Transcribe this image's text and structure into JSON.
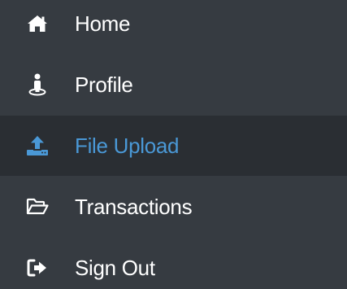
{
  "colors": {
    "background": "#363b41",
    "active_background": "#2a2e33",
    "text": "#ffffff",
    "accent": "#4a98d6"
  },
  "sidebar": {
    "items": [
      {
        "label": "Home",
        "icon": "home-icon",
        "active": false
      },
      {
        "label": "Profile",
        "icon": "user-icon",
        "active": false
      },
      {
        "label": "File Upload",
        "icon": "upload-icon",
        "active": true
      },
      {
        "label": "Transactions",
        "icon": "folder-open-icon",
        "active": false
      },
      {
        "label": "Sign Out",
        "icon": "sign-out-icon",
        "active": false
      }
    ]
  }
}
